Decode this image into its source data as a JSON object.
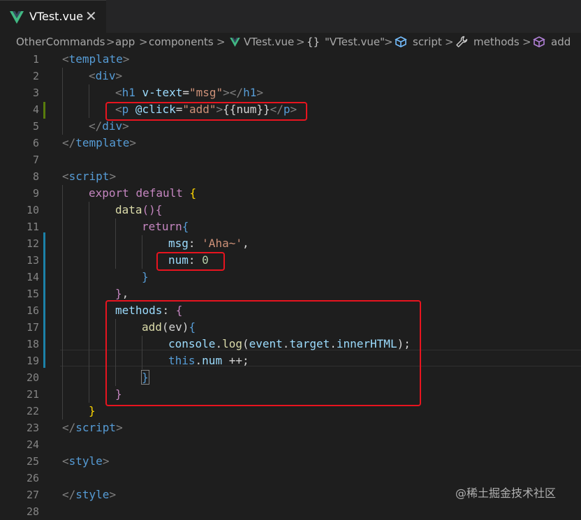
{
  "tab": {
    "filename": "VTest.vue",
    "close_glyph": "✕",
    "icon": "vue-logo-icon"
  },
  "breadcrumb": {
    "items": [
      "OtherCommands",
      "app",
      "components",
      "VTest.vue",
      "\"VTest.vue\"",
      "script",
      "methods",
      "add"
    ],
    "separator": ">",
    "braces_symbol": "{}"
  },
  "editor": {
    "line_numbers": [
      "1",
      "2",
      "3",
      "4",
      "5",
      "6",
      "7",
      "8",
      "9",
      "10",
      "11",
      "12",
      "13",
      "14",
      "15",
      "16",
      "17",
      "18",
      "19",
      "20",
      "21",
      "22",
      "23",
      "24",
      "25",
      "26",
      "27",
      "28"
    ],
    "code": {
      "l1": {
        "a": "<",
        "b": "template",
        "c": ">"
      },
      "l2": {
        "a": "<",
        "b": "div",
        "c": ">"
      },
      "l3": {
        "a": "<",
        "b": "h1",
        "c": " v-text",
        "d": "=",
        "e": "\"msg\"",
        "f": "></",
        "g": "h1",
        "h": ">"
      },
      "l4": {
        "a": "<",
        "b": "p",
        "c": " @click",
        "d": "=",
        "e": "\"add\"",
        "f": ">",
        "g": "{{num}}",
        "h": "</",
        "i": "p",
        "j": ">"
      },
      "l5": {
        "a": "</",
        "b": "div",
        "c": ">"
      },
      "l6": {
        "a": "</",
        "b": "template",
        "c": ">"
      },
      "l8": {
        "a": "<",
        "b": "script",
        "c": ">"
      },
      "l9": {
        "a": "export",
        "b": " ",
        "c": "default",
        "d": " ",
        "e": "{"
      },
      "l10": {
        "a": "data",
        "b": "()",
        "c": "{"
      },
      "l11": {
        "a": "return",
        "b": "{"
      },
      "l12": {
        "a": "msg",
        "b": ": ",
        "c": "'Aha~'",
        "d": ","
      },
      "l13": {
        "a": "num",
        "b": ": ",
        "c": "0"
      },
      "l14": {
        "a": "}"
      },
      "l15": {
        "a": "}",
        "b": ","
      },
      "l16": {
        "a": "methods",
        "b": ": ",
        "c": "{"
      },
      "l17": {
        "a": "add",
        "b": "(ev)",
        "c": "{"
      },
      "l18": {
        "a": "console",
        "b": ".",
        "c": "log",
        "d": "(",
        "e": "event",
        "f": ".",
        "g": "target",
        "h": ".",
        "i": "innerHTML",
        "j": ");"
      },
      "l19": {
        "a": "this",
        "b": ".",
        "c": "num",
        "d": " ++;"
      },
      "l20": {
        "a": "}"
      },
      "l21": {
        "a": "}"
      },
      "l22": {
        "a": "}"
      },
      "l23": {
        "a": "</",
        "b": "script",
        "c": ">"
      },
      "l25": {
        "a": "<",
        "b": "style",
        "c": ">"
      },
      "l27": {
        "a": "</",
        "b": "style",
        "c": ">"
      }
    }
  },
  "annotations": [
    "line-4-highlight",
    "num-zero-highlight",
    "methods-block-highlight"
  ],
  "colors": {
    "background": "#1e1e1e",
    "tag": "#569cd6",
    "attribute": "#9cdcfe",
    "string": "#ce9178",
    "keyword": "#c586c0",
    "function": "#dcdcaa",
    "number": "#b5cea8",
    "bracket": "#ffd700",
    "highlight_box": "#e8141f",
    "vue_green": "#41b883"
  },
  "watermark": "@稀土掘金技术社区"
}
